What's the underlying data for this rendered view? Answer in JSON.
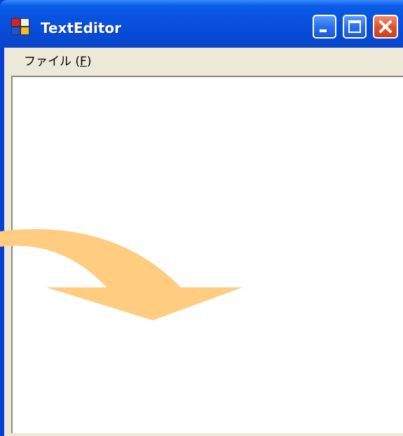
{
  "window": {
    "title": "TextEditor",
    "icon": "app-window-icon",
    "controls": {
      "minimize": "minimize-icon",
      "maximize": "maximize-icon",
      "close": "close-icon"
    }
  },
  "menubar": {
    "items": [
      {
        "label_prefix": "ファイル (",
        "accel": "F",
        "label_suffix": ")"
      }
    ]
  },
  "editor": {
    "text": ""
  },
  "annotation": {
    "icon": "curved-arrow-icon",
    "color": "#ffcc80"
  },
  "colors": {
    "titlebar": "#0852df",
    "menubar": "#ece9d8",
    "close_button": "#e0532e"
  }
}
